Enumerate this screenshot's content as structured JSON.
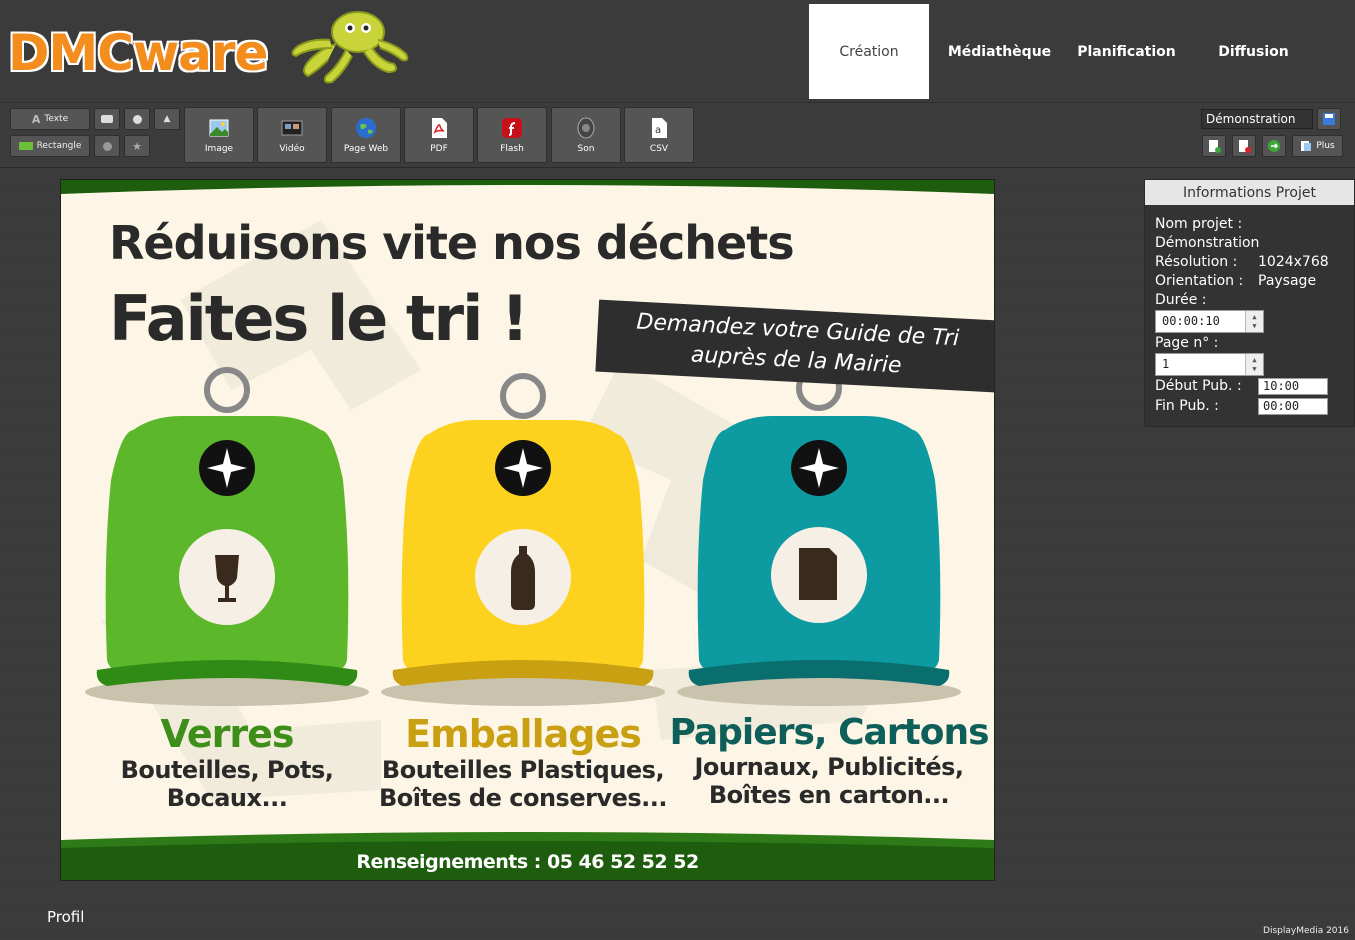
{
  "app": {
    "name": "DMCware"
  },
  "nav": {
    "items": [
      {
        "label": "Création",
        "active": true
      },
      {
        "label": "Médiathèque",
        "active": false
      },
      {
        "label": "Planification",
        "active": false
      },
      {
        "label": "Diffusion",
        "active": false
      }
    ]
  },
  "toolbar": {
    "text_label": "Texte",
    "rectangle_label": "Rectangle",
    "media_buttons": [
      {
        "label": "Image",
        "icon": "image-icon"
      },
      {
        "label": "Vidéo",
        "icon": "video-icon"
      },
      {
        "label": "Page Web",
        "icon": "globe-icon"
      },
      {
        "label": "PDF",
        "icon": "pdf-icon"
      },
      {
        "label": "Flash",
        "icon": "flash-icon"
      },
      {
        "label": "Son",
        "icon": "speaker-icon"
      },
      {
        "label": "CSV",
        "icon": "csv-icon"
      }
    ],
    "project_value": "Démonstration",
    "plus_label": "Plus"
  },
  "poster": {
    "title": "Réduisons vite nos déchets",
    "subtitle": "Faites le tri !",
    "banner_line1": "Demandez votre Guide de Tri",
    "banner_line2": "auprès de la Mairie",
    "bins": [
      {
        "title": "Verres",
        "line1": "Bouteilles, Pots,",
        "line2": "Bocaux...",
        "color": "#5cb82a",
        "dark": "#2f8a16",
        "title_color": "#3e8f1a"
      },
      {
        "title": "Emballages",
        "line1": "Bouteilles Plastiques,",
        "line2": "Boîtes de conserves...",
        "color": "#fdd21f",
        "dark": "#c9a012",
        "title_color": "#c9a012"
      },
      {
        "title": "Papiers, Cartons",
        "line1": "Journaux, Publicités,",
        "line2": "Boîtes en carton...",
        "color": "#0d9aa0",
        "dark": "#0a6e6e",
        "title_color": "#0e5e5a"
      }
    ],
    "footer": "Renseignements : 05 46 52 52 52"
  },
  "panel": {
    "header": "Informations Projet",
    "nom_label": "Nom projet :",
    "nom_value": "Démonstration",
    "resolution_label": "Résolution :",
    "resolution_value": "1024x768",
    "orientation_label": "Orientation :",
    "orientation_value": "Paysage",
    "duree_label": "Durée :",
    "duree_value": "00:00:10",
    "page_label": "Page n° :",
    "page_value": "1",
    "debut_label": "Début Pub. :",
    "debut_value": "10:00",
    "fin_label": "Fin Pub. :",
    "fin_value": "00:00"
  },
  "footer": {
    "profil": "Profil",
    "copyright": "DisplayMedia 2016"
  },
  "colors": {
    "accent_orange": "#f28d1e",
    "poster_bg": "#fdf6e6",
    "poster_dark_green": "#1e5c0e"
  }
}
